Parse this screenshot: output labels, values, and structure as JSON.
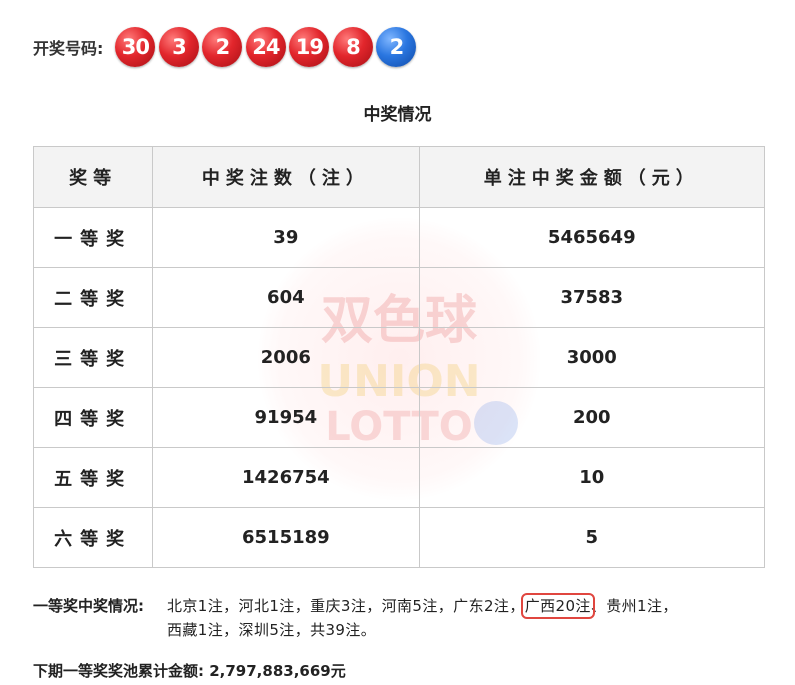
{
  "draw": {
    "label": "开奖号码:",
    "red_balls": [
      "30",
      "3",
      "2",
      "24",
      "19",
      "8"
    ],
    "blue_balls": [
      "2"
    ]
  },
  "section_title": "中奖情况",
  "table": {
    "headers": [
      "奖等",
      "中奖注数（注）",
      "单注中奖金额（元）"
    ],
    "rows": [
      {
        "level": "一等奖",
        "count": "39",
        "amount": "5465649"
      },
      {
        "level": "二等奖",
        "count": "604",
        "amount": "37583"
      },
      {
        "level": "三等奖",
        "count": "2006",
        "amount": "3000"
      },
      {
        "level": "四等奖",
        "count": "91954",
        "amount": "200"
      },
      {
        "level": "五等奖",
        "count": "1426754",
        "amount": "10"
      },
      {
        "level": "六等奖",
        "count": "6515189",
        "amount": "5"
      }
    ]
  },
  "first_prize": {
    "label": "一等奖中奖情况:",
    "regions_before": "北京1注，河北1注，重庆3注，河南5注，广东2注，",
    "regions_highlighted": "广西20注",
    "regions_after": "、贵州1注，",
    "regions_line2": "西藏1注，深圳5注，共39注。"
  },
  "pool": {
    "label": "下期一等奖奖池累计金额:",
    "amount": "2,797,883,669元"
  },
  "watermark": {
    "title": "双色球",
    "line1": "UNION",
    "line2": "LOTTO"
  },
  "colors": {
    "red_ball": "#e2262c",
    "blue_ball": "#2a76e0",
    "highlight_box": "#e0463f",
    "header_bg": "#f2f2f2"
  }
}
